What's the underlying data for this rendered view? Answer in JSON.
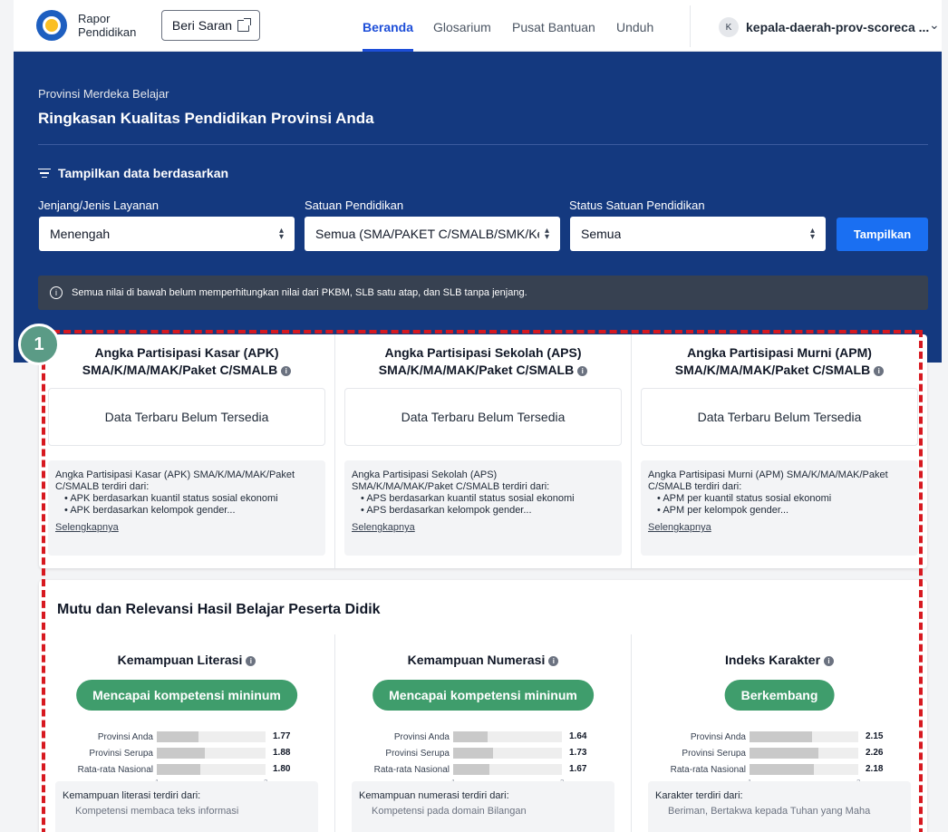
{
  "nav": {
    "brand_line1": "Rapor",
    "brand_line2": "Pendidikan",
    "saran_label": "Beri Saran",
    "tabs": [
      {
        "label": "Beranda"
      },
      {
        "label": "Glosarium"
      },
      {
        "label": "Pusat Bantuan"
      },
      {
        "label": "Unduh"
      }
    ],
    "user_initial": "K",
    "user_name": "kepala-daerah-prov-scoreca ...",
    "accent": "#1d4ed8"
  },
  "hero": {
    "subtitle": "Provinsi Merdeka Belajar",
    "title": "Ringkasan Kualitas Pendidikan Provinsi Anda",
    "filter_heading": "Tampilkan data berdasarkan",
    "filters": [
      {
        "label": "Jenjang/Jenis Layanan",
        "value": "Menengah"
      },
      {
        "label": "Satuan Pendidikan",
        "value": "Semua (SMA/PAKET C/SMALB/SMK/Ke"
      },
      {
        "label": "Status Satuan Pendidikan",
        "value": "Semua"
      }
    ],
    "submit_label": "Tampilkan",
    "info": "Semua nilai di bawah belum memperhitungkan nilai dari PKBM, SLB satu atap, dan SLB tanpa jenjang.",
    "bg_color": "#14397f"
  },
  "badge": "1",
  "participation": [
    {
      "title_l1": "Angka Partisipasi Kasar (APK)",
      "title_l2": "SMA/K/MA/MAK/Paket C/SMALB",
      "status": "Data Terbaru Belum Tersedia",
      "desc_l1": "Angka Partisipasi Kasar (APK) SMA/K/MA/MAK/Paket",
      "desc_l2": "C/SMALB terdiri dari:",
      "bullet1": "APK berdasarkan kuantil status sosial ekonomi",
      "bullet2": "APK berdasarkan kelompok gender...",
      "more": "Selengkapnya"
    },
    {
      "title_l1": "Angka Partisipasi Sekolah (APS)",
      "title_l2": "SMA/K/MA/MAK/Paket C/SMALB",
      "status": "Data Terbaru Belum Tersedia",
      "desc_l1": "Angka Partisipasi Sekolah (APS)",
      "desc_l2": "SMA/K/MA/MAK/Paket C/SMALB terdiri dari:",
      "bullet1": "APS berdasarkan kuantil status sosial ekonomi",
      "bullet2": "APS berdasarkan kelompok gender...",
      "more": "Selengkapnya"
    },
    {
      "title_l1": "Angka Partisipasi Murni (APM)",
      "title_l2": "SMA/K/MA/MAK/Paket C/SMALB",
      "status": "Data Terbaru Belum Tersedia",
      "desc_l1": "Angka Partisipasi Murni (APM) SMA/K/MA/MAK/Paket",
      "desc_l2": "C/SMALB terdiri dari:",
      "bullet1": "APM per kuantil status sosial ekonomi",
      "bullet2": "APM per kelompok gender...",
      "more": "Selengkapnya"
    }
  ],
  "quality": {
    "section_title": "Mutu dan Relevansi Hasil Belajar Peserta Didik",
    "pill_color": "#3f9d6c",
    "row_labels": [
      "Provinsi Anda",
      "Provinsi Serupa",
      "Rata-rata Nasional"
    ],
    "axis_min": "1",
    "axis_max": "3",
    "metrics": [
      {
        "title": "Kemampuan Literasi",
        "status": "Mencapai kompetensi mininum",
        "values": [
          1.77,
          1.88,
          1.8
        ],
        "value_labels": [
          "1.77",
          "1.88",
          "1.80"
        ],
        "desc": "Kemampuan literasi terdiri dari:",
        "desc_cut": "Kompetensi membaca teks informasi"
      },
      {
        "title": "Kemampuan Numerasi",
        "status": "Mencapai kompetensi mininum",
        "values": [
          1.64,
          1.73,
          1.67
        ],
        "value_labels": [
          "1.64",
          "1.73",
          "1.67"
        ],
        "desc": "Kemampuan numerasi terdiri dari:",
        "desc_cut": "Kompetensi pada domain Bilangan"
      },
      {
        "title": "Indeks Karakter",
        "status": "Berkembang",
        "values": [
          2.15,
          2.26,
          2.18
        ],
        "value_labels": [
          "2.15",
          "2.26",
          "2.18"
        ],
        "desc": "Karakter terdiri dari:",
        "desc_cut": "Beriman, Bertakwa kepada Tuhan yang Maha"
      }
    ]
  }
}
